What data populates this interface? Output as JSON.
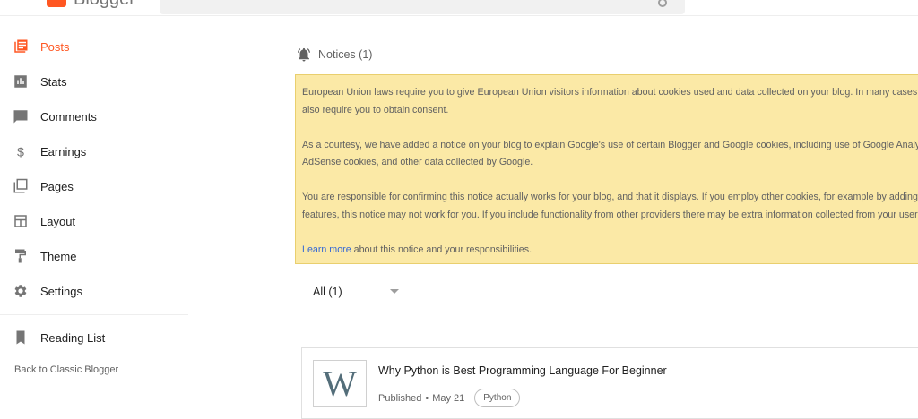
{
  "app": {
    "name": "Blogger"
  },
  "sidebar": {
    "items": [
      {
        "label": "Posts",
        "icon": "posts-icon",
        "active": true
      },
      {
        "label": "Stats",
        "icon": "stats-icon"
      },
      {
        "label": "Comments",
        "icon": "comments-icon"
      },
      {
        "label": "Earnings",
        "icon": "dollar-icon"
      },
      {
        "label": "Pages",
        "icon": "pages-icon"
      },
      {
        "label": "Layout",
        "icon": "layout-icon"
      },
      {
        "label": "Theme",
        "icon": "paint-roller-icon"
      },
      {
        "label": "Settings",
        "icon": "gear-icon"
      }
    ],
    "reading_list": {
      "label": "Reading List",
      "icon": "bookmark-icon"
    },
    "classic_link": "Back to Classic Blogger"
  },
  "notices": {
    "heading": "Notices (1)",
    "paragraphs": [
      {
        "line1": "European Union laws require you to give European Union visitors information about cookies used and data collected on your blog. In many cases, these laws",
        "line2": "also require you to obtain consent."
      },
      {
        "line1": "As a courtesy, we have added a notice on your blog to explain Google's use of certain Blogger and Google cookies, including use of Google Analytics and",
        "line2": "AdSense cookies, and other data collected by Google."
      },
      {
        "line1": "You are responsible for confirming this notice actually works for your blog, and that it displays. If you employ other cookies, for example by adding third-party",
        "line2": "features, this notice may not work for you. If you include functionality from other providers there may be extra information collected from your users."
      }
    ],
    "learn_more": "Learn more",
    "learn_more_suffix": " about this notice and your responsibilities."
  },
  "filter": {
    "selected": "All (1)"
  },
  "posts": [
    {
      "thumb_letter": "W",
      "title": "Why Python is Best Programming Language For Beginner",
      "status": "Published",
      "separator": "•",
      "date": "May 21",
      "tag": "Python"
    }
  ],
  "colors": {
    "accent": "#ff5722",
    "notice_bg": "#fbe9a6",
    "link": "#3367d6"
  }
}
